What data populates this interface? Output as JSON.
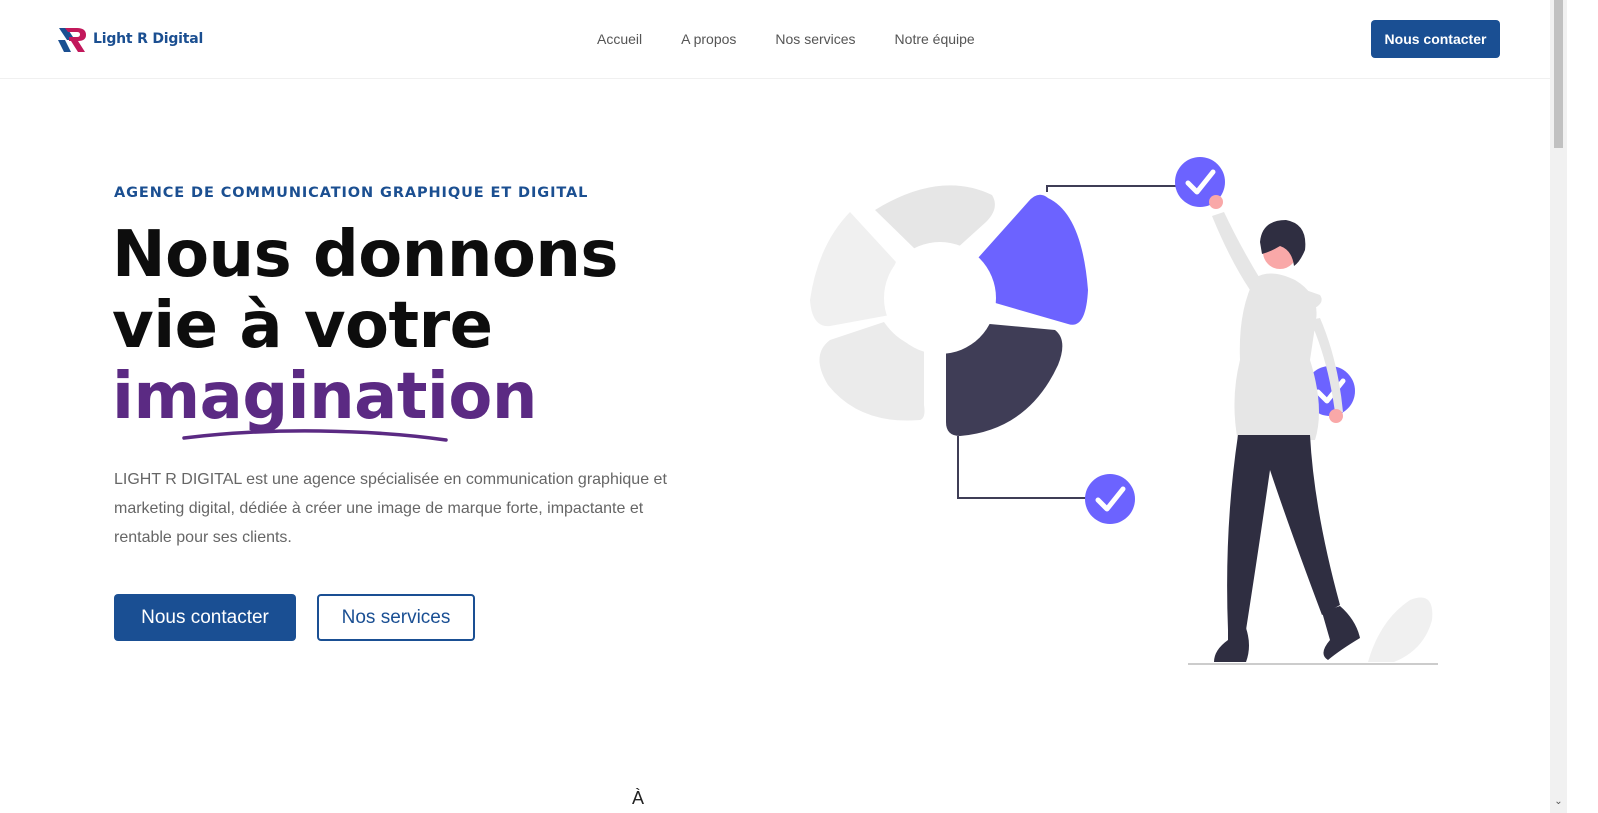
{
  "header": {
    "logo_text": "Light R Digital",
    "nav": [
      {
        "label": "Accueil"
      },
      {
        "label": "A propos"
      },
      {
        "label": "Nos services"
      },
      {
        "label": "Notre équipe"
      }
    ],
    "cta_label": "Nous contacter"
  },
  "hero": {
    "eyebrow": "AGENCE DE COMMUNICATION GRAPHIQUE ET DIGITAL",
    "headline_line1": "Nous donnons",
    "headline_line2": "vie à votre",
    "headline_accent": "imagination",
    "intro": "LIGHT R DIGITAL est une agence spécialisée en communication graphique et marketing digital, dédiée à créer une image de marque forte, impactante et rentable pour ses clients.",
    "primary_button": "Nous contacter",
    "secondary_button": "Nos services"
  },
  "colors": {
    "brand_blue": "#1a4f93",
    "accent_purple": "#5b2a83",
    "illustration_violet": "#6c63ff",
    "illustration_dark": "#3f3d56"
  },
  "below_fold_glyph": "À"
}
